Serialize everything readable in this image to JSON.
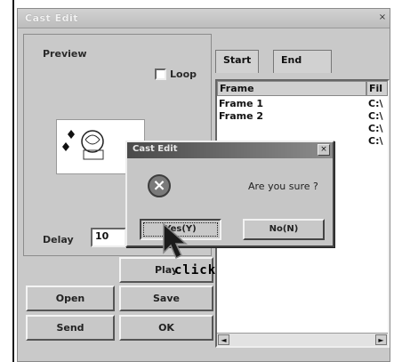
{
  "window": {
    "title": "Cast Edit",
    "close_glyph": "×"
  },
  "preview": {
    "heading": "Preview",
    "loop_label": "Loop",
    "loop_checked": false
  },
  "delay": {
    "label": "Delay",
    "value": "10"
  },
  "buttons": {
    "play": "Play",
    "open": "Open",
    "save": "Save",
    "send": "Send",
    "ok": "OK"
  },
  "tabs": [
    {
      "label": "Start",
      "active": true
    },
    {
      "label": "End",
      "active": false
    }
  ],
  "frame_list": {
    "headers": [
      "Frame",
      "Fil"
    ],
    "rows": [
      {
        "frame": "Frame 1",
        "file": "C:\\"
      },
      {
        "frame": "Frame 2",
        "file": "C:\\"
      },
      {
        "frame": "",
        "file": "C:\\"
      },
      {
        "frame": "",
        "file": "C:\\"
      }
    ],
    "scroll_left": "◄",
    "scroll_right": "►"
  },
  "dialog": {
    "title": "Cast Edit",
    "message": "Are you sure ?",
    "yes_label": "Yes(Y)",
    "no_label": "No(N)",
    "close_glyph": "×",
    "icon": "error-icon"
  },
  "annotation": {
    "text": "click"
  }
}
